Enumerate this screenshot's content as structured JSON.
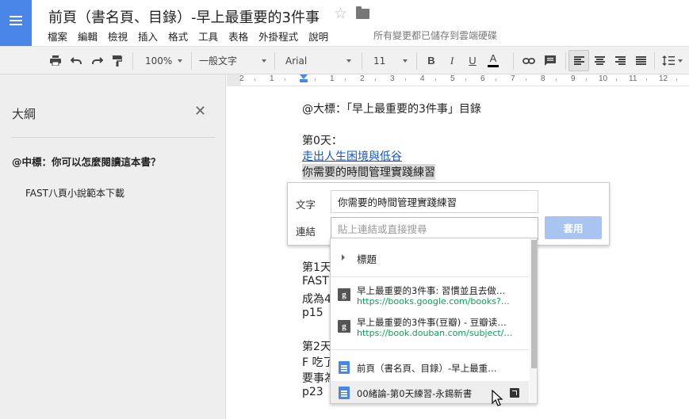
{
  "header": {
    "title": "前頁（書名頁、目錄）-早上最重要的3件事",
    "menu": [
      "檔案",
      "編輯",
      "檢視",
      "插入",
      "格式",
      "工具",
      "表格",
      "外掛程式",
      "說明"
    ],
    "save_status": "所有變更都已儲存到雲端硬碟"
  },
  "toolbar": {
    "zoom": "100%",
    "style": "一般文字",
    "font": "Arial",
    "size": "11",
    "bold": "B",
    "italic": "I",
    "underline": "U",
    "font_color": "A",
    "text_color": "#000000"
  },
  "ruler": {
    "labels": [
      "2",
      "1",
      "1",
      "2",
      "3",
      "4",
      "5",
      "6",
      "7",
      "8",
      "9",
      "10",
      "11",
      "12"
    ]
  },
  "sidebar": {
    "title": "大綱",
    "items": [
      {
        "label": "@中標：你可以怎麼閱讀這本書？"
      },
      {
        "label": "FAST八頁小說範本下載"
      }
    ]
  },
  "document": {
    "lines": [
      "@大標：「早上最重要的3件事」目錄",
      "第0天：",
      "走出人生困境與低谷",
      "你需要的時間管理實踐練習",
      "第1天",
      "FAST",
      "成為4",
      "p15",
      "第2天",
      "F 吃了",
      "要事為",
      "p23"
    ]
  },
  "link_dialog": {
    "text_label": "文字",
    "text_value": "你需要的時間管理實踐練習",
    "link_label": "連結",
    "link_placeholder": "貼上連結或直接搜尋",
    "apply_label": "套用"
  },
  "suggestions": {
    "headings_label": "標題",
    "items": [
      {
        "icon": "google-icon",
        "title": "早上最重要的3件事: 習慣並且去做…",
        "url": "https://books.google.com/books?…"
      },
      {
        "icon": "google-icon",
        "title": "早上最重要的3件事(豆瓣) - 豆瓣读…",
        "url": "https://book.douban.com/subject/…"
      },
      {
        "icon": "doc-icon",
        "title": "前頁（書名頁、目錄）-早上最重…"
      },
      {
        "icon": "doc-icon",
        "title": "00緒論-第0天練習-永錫新書"
      }
    ]
  },
  "colors": {
    "brand_blue": "#4a86e8",
    "link_blue": "#1155cc",
    "url_green": "#0f9d58",
    "apply_disabled": "#a9c4f0"
  }
}
